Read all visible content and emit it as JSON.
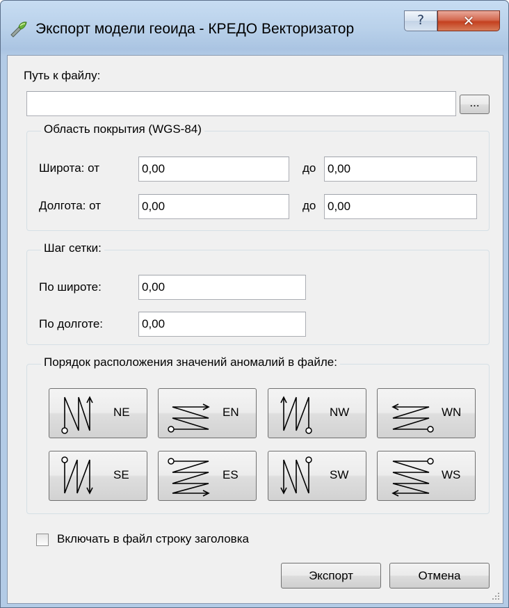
{
  "window": {
    "title": "Экспорт модели геоида - КРЕДО Векторизатор",
    "help_glyph": "?",
    "close_glyph": "✕"
  },
  "file": {
    "label": "Путь к файлу:",
    "value": "",
    "browse_label": "..."
  },
  "coverage": {
    "title": "Область покрытия (WGS-84)",
    "lat_label": "Широта: от",
    "lat_from": "0,00",
    "lat_to_label": "до",
    "lat_to": "0,00",
    "lon_label": "Долгота: от",
    "lon_from": "0,00",
    "lon_to_label": "до",
    "lon_to": "0,00"
  },
  "grid": {
    "title": "Шаг сетки:",
    "lat_label": "По широте:",
    "lat_value": "0,00",
    "lon_label": "По долготе:",
    "lon_value": "0,00"
  },
  "order": {
    "title": "Порядок расположения значений аномалий в файле:",
    "buttons": [
      {
        "code": "NE",
        "icon": "zigzag-vertical-start-bottom-left-icon"
      },
      {
        "code": "EN",
        "icon": "zigzag-horizontal-start-bottom-left-icon"
      },
      {
        "code": "NW",
        "icon": "zigzag-vertical-start-bottom-right-icon"
      },
      {
        "code": "WN",
        "icon": "zigzag-horizontal-start-bottom-right-icon"
      },
      {
        "code": "SE",
        "icon": "zigzag-vertical-start-top-left-icon"
      },
      {
        "code": "ES",
        "icon": "zigzag-horizontal-start-top-left-icon"
      },
      {
        "code": "SW",
        "icon": "zigzag-vertical-start-top-right-icon"
      },
      {
        "code": "WS",
        "icon": "zigzag-horizontal-start-top-right-icon"
      }
    ]
  },
  "header_checkbox": {
    "label": "Включать в файл строку заголовка",
    "checked": false
  },
  "actions": {
    "export_label": "Экспорт",
    "cancel_label": "Отмена"
  },
  "colors": {
    "title_bar": "#b9d1ea",
    "dialog_bg": "#f0f0f0",
    "close_button": "#c4401f"
  }
}
